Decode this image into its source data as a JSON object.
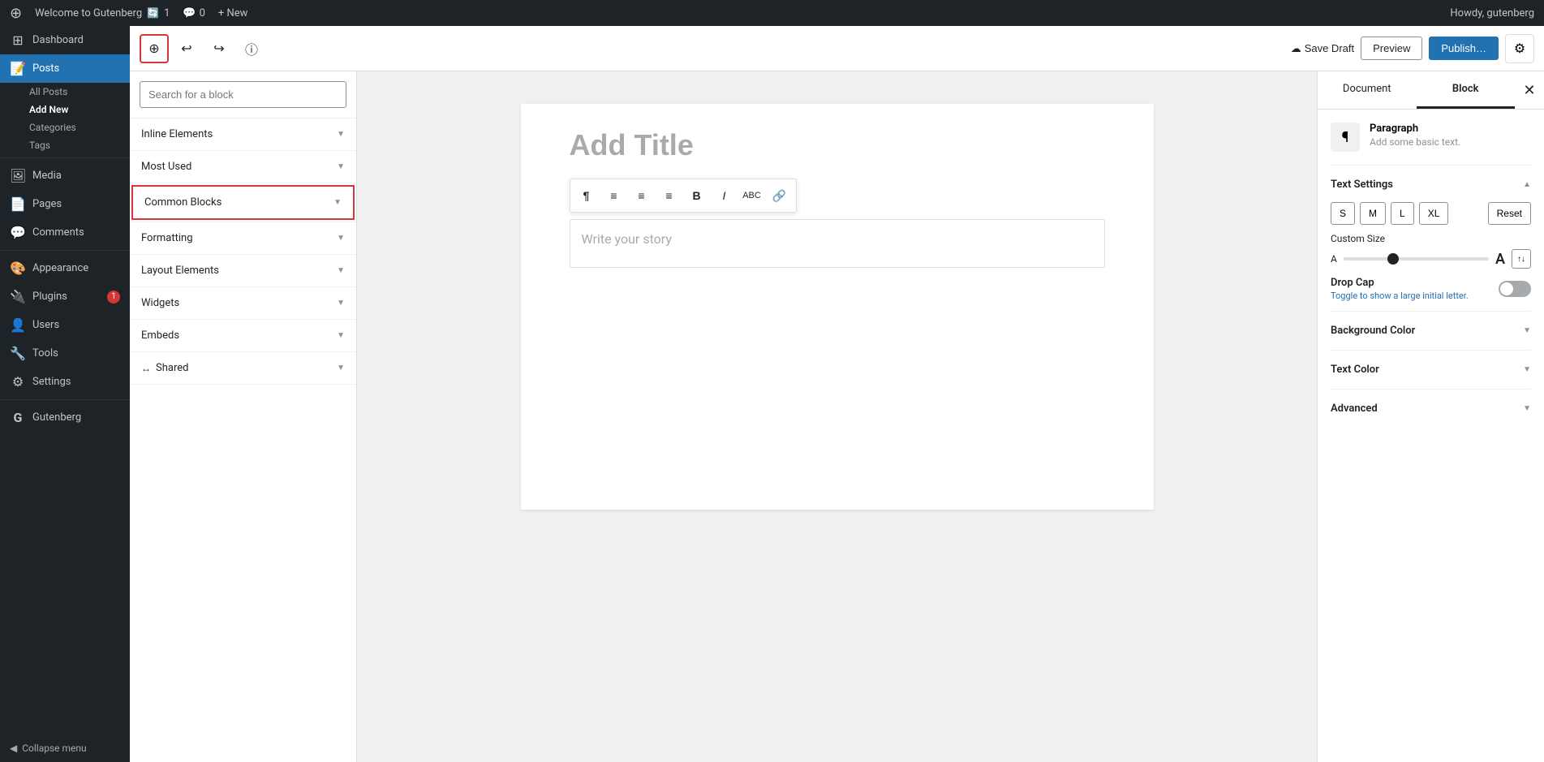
{
  "adminbar": {
    "logo": "⊕",
    "site_name": "Welcome to Gutenberg",
    "comments_count": "0",
    "new_label": "+ New",
    "user_label": "Howdy, gutenberg"
  },
  "wp_sidebar": {
    "items": [
      {
        "id": "dashboard",
        "icon": "⊞",
        "label": "Dashboard"
      },
      {
        "id": "posts",
        "icon": "📝",
        "label": "Posts",
        "active": true
      },
      {
        "id": "media",
        "icon": "🖼",
        "label": "Media"
      },
      {
        "id": "pages",
        "icon": "📄",
        "label": "Pages"
      },
      {
        "id": "comments",
        "icon": "💬",
        "label": "Comments"
      },
      {
        "id": "appearance",
        "icon": "🎨",
        "label": "Appearance"
      },
      {
        "id": "plugins",
        "icon": "🔌",
        "label": "Plugins",
        "badge": "1"
      },
      {
        "id": "users",
        "icon": "👤",
        "label": "Users"
      },
      {
        "id": "tools",
        "icon": "🔧",
        "label": "Tools"
      },
      {
        "id": "settings",
        "icon": "⚙",
        "label": "Settings"
      },
      {
        "id": "gutenberg",
        "icon": "G",
        "label": "Gutenberg"
      }
    ],
    "posts_submenu": [
      {
        "label": "All Posts"
      },
      {
        "label": "Add New"
      },
      {
        "label": "Categories"
      },
      {
        "label": "Tags"
      }
    ],
    "collapse_label": "Collapse menu"
  },
  "editor_toolbar": {
    "inserter_icon": "⊕",
    "undo_icon": "↩",
    "redo_icon": "↪",
    "info_icon": "ⓘ",
    "save_draft_label": "Save Draft",
    "preview_label": "Preview",
    "publish_label": "Publish…",
    "settings_icon": "⚙"
  },
  "block_inserter": {
    "search_placeholder": "Search for a block",
    "categories": [
      {
        "id": "inline-elements",
        "label": "Inline Elements",
        "highlighted": false
      },
      {
        "id": "most-used",
        "label": "Most Used",
        "highlighted": false
      },
      {
        "id": "common-blocks",
        "label": "Common Blocks",
        "highlighted": true
      },
      {
        "id": "formatting",
        "label": "Formatting",
        "highlighted": false
      },
      {
        "id": "layout-elements",
        "label": "Layout Elements",
        "highlighted": false
      },
      {
        "id": "widgets",
        "label": "Widgets",
        "highlighted": false
      },
      {
        "id": "embeds",
        "label": "Embeds",
        "highlighted": false
      },
      {
        "id": "shared",
        "label": "Shared",
        "is_shared": true,
        "highlighted": false
      }
    ]
  },
  "editor": {
    "title_placeholder": "Add Title",
    "content_placeholder": "Write your story"
  },
  "block_toolbar": {
    "buttons": [
      {
        "id": "paragraph",
        "icon": "¶",
        "title": "Paragraph"
      },
      {
        "id": "align-left",
        "icon": "≡",
        "title": "Align Left"
      },
      {
        "id": "align-center",
        "icon": "≡",
        "title": "Align Center"
      },
      {
        "id": "align-right",
        "icon": "≡",
        "title": "Align Right"
      },
      {
        "id": "bold",
        "icon": "B",
        "title": "Bold"
      },
      {
        "id": "italic",
        "icon": "I",
        "title": "Italic"
      },
      {
        "id": "strikethrough",
        "icon": "S̶",
        "title": "Strikethrough"
      },
      {
        "id": "link",
        "icon": "🔗",
        "title": "Link"
      }
    ]
  },
  "right_panel": {
    "document_tab": "Document",
    "block_tab": "Block",
    "active_tab": "block",
    "block_type": {
      "icon": "¶",
      "name": "Paragraph",
      "description": "Add some basic text."
    },
    "text_settings": {
      "title": "Text Settings",
      "sizes": [
        "S",
        "M",
        "L",
        "XL"
      ],
      "reset_label": "Reset",
      "custom_size_label": "Custom Size",
      "drop_cap_label": "Drop Cap",
      "drop_cap_desc": "Toggle to show a large initial letter."
    },
    "background_color": {
      "title": "Background Color"
    },
    "text_color": {
      "title": "Text Color"
    },
    "advanced": {
      "title": "Advanced"
    }
  }
}
